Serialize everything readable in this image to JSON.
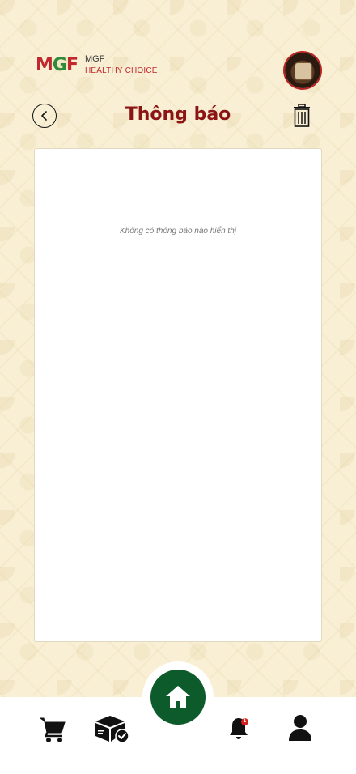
{
  "header": {
    "logo_mark": [
      "M",
      "G",
      "F"
    ],
    "logo_name": "MGF",
    "logo_tagline": "HEALTHY CHOICE"
  },
  "page": {
    "title": "Thông báo",
    "empty_message": "Không có thông báo nào hiển thị"
  },
  "bottom_nav": {
    "notification_badge": "1"
  },
  "colors": {
    "brand_red": "#8b1414",
    "brand_green": "#0d5a2a",
    "background": "#f8efd4"
  }
}
